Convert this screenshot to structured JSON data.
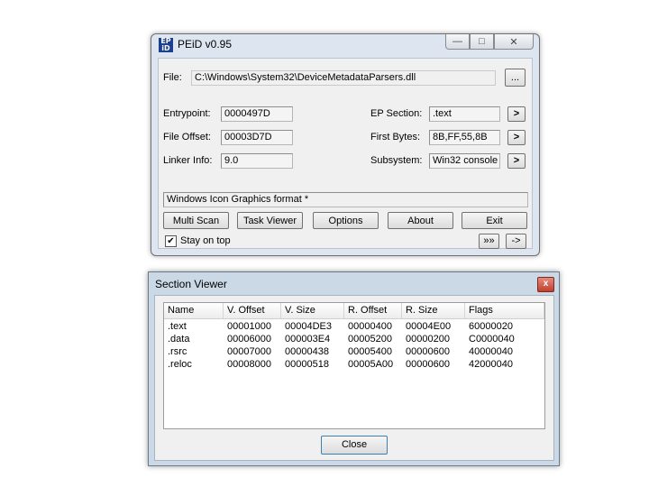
{
  "peid": {
    "app_icon": [
      "EP",
      "iD"
    ],
    "title": "PEiD v0.95",
    "window_buttons": {
      "minimize": "—",
      "maximize": "□",
      "close": "✕"
    },
    "file_label": "File:",
    "file_path": "C:\\Windows\\System32\\DeviceMetadataParsers.dll",
    "browse_label": "...",
    "entrypoint_label": "Entrypoint:",
    "entrypoint_value": "0000497D",
    "file_offset_label": "File Offset:",
    "file_offset_value": "00003D7D",
    "linker_label": "Linker Info:",
    "linker_value": "9.0",
    "ep_section_label": "EP Section:",
    "ep_section_value": ".text",
    "first_bytes_label": "First Bytes:",
    "first_bytes_value": "8B,FF,55,8B",
    "subsystem_label": "Subsystem:",
    "subsystem_value": "Win32 console",
    "arrow_label": ">",
    "result": "Windows Icon Graphics format *",
    "buttons": {
      "multi_scan": "Multi Scan",
      "task_viewer": "Task Viewer",
      "options": "Options",
      "about": "About",
      "exit": "Exit"
    },
    "stay_on_top_label": "Stay on top",
    "stay_on_top_checked": true,
    "check_mark": "✔",
    "ext_button": "»»",
    "go_button": "->"
  },
  "section_viewer": {
    "title": "Section Viewer",
    "close_glyph": "x",
    "columns": [
      "Name",
      "V. Offset",
      "V. Size",
      "R. Offset",
      "R. Size",
      "Flags"
    ],
    "rows": [
      [
        ".text",
        "00001000",
        "00004DE3",
        "00000400",
        "00004E00",
        "60000020"
      ],
      [
        ".data",
        "00006000",
        "000003E4",
        "00005200",
        "00000200",
        "C0000040"
      ],
      [
        ".rsrc",
        "00007000",
        "00000438",
        "00005400",
        "00000600",
        "40000040"
      ],
      [
        ".reloc",
        "00008000",
        "00000518",
        "00005A00",
        "00000600",
        "42000040"
      ]
    ],
    "close_button": "Close"
  }
}
